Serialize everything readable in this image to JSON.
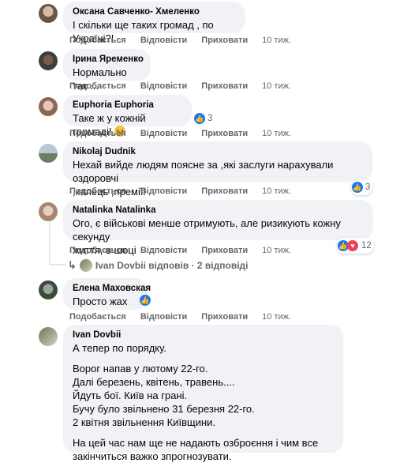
{
  "actions": {
    "like": "Подобається",
    "reply": "Відповісти",
    "hide": "Приховати"
  },
  "comments": [
    {
      "author": "Оксана Савченко- Хмеленко",
      "text": "І скільки ще таких громад , по Україні?!",
      "time": "10 тиж."
    },
    {
      "author": "Ірина Яременко",
      "text": "Нормально так ...",
      "time": "10 тиж."
    },
    {
      "author": "Euphoria Euphoria",
      "text": "Таке ж у кожній громаді!",
      "time": "10 тиж.",
      "reactions": "3"
    },
    {
      "author": "Nikolaj Dudnik",
      "text": "Нехай вийде людям поясне за ,які заслуги нарахували оздоровчі\n,капець ,премії!",
      "time": "10 тиж.",
      "reactions": "3"
    },
    {
      "author": "Natalinka Natalinka",
      "text": "Ого, є військові менше отримують, але ризикують кожну секунду\nжиття, в шоці",
      "time": "10 тиж.",
      "reactions": "12",
      "replies_text": "Ivan Dovbii відповів · 2 відповіді"
    },
    {
      "author": "Елена Маховская",
      "text": "Просто жах",
      "time": "10 тиж.",
      "reactions": ""
    },
    {
      "author": "Ivan Dovbii",
      "text_blocks": [
        "А тепер по порядку.",
        "Ворог напав у лютому 22-го.\nДалі березень, квітень, травень....\nЙдуть бої. Київ на грані.\nБучу було звільнено 31 березня 22-го.\n2 квітня звільнення Київщини.",
        "На цей час нам ще не надають озброєння і чим все\nзакінчиться важко зпрогнозувати."
      ]
    }
  ],
  "colors": {
    "bubble": "#f0f2f5",
    "like": "#1877f2",
    "heart": "#f33e58",
    "meta": "#65676b"
  }
}
